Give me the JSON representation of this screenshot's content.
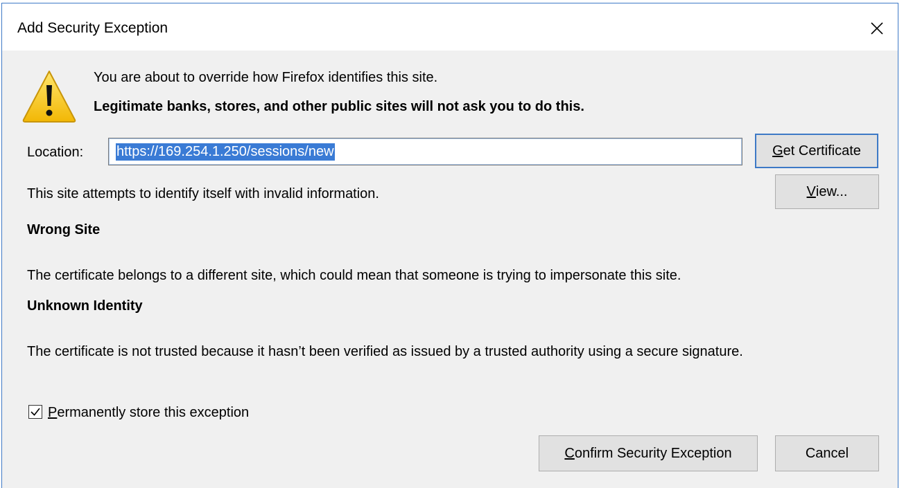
{
  "window": {
    "title": "Add Security Exception"
  },
  "warning": {
    "line1": "You are about to override how Firefox identifies this site.",
    "line2": "Legitimate banks, stores, and other public sites will not ask you to do this."
  },
  "location": {
    "label": "Location:",
    "value": "https://169.254.1.250/sessions/new"
  },
  "buttons": {
    "get_certificate_prefix": "G",
    "get_certificate_rest": "et Certificate",
    "view_prefix": "V",
    "view_rest": "iew...",
    "confirm_prefix": "C",
    "confirm_rest": "onfirm Security Exception",
    "cancel": "Cancel"
  },
  "status": {
    "intro": "This site attempts to identify itself with invalid information.",
    "wrong_site_heading": "Wrong Site",
    "wrong_site_text": "The certificate belongs to a different site, which could mean that someone is trying to impersonate this site.",
    "unknown_identity_heading": "Unknown Identity",
    "unknown_identity_text": "The certificate is not trusted because it hasn’t been verified as issued by a trusted authority using a secure signature."
  },
  "permanent": {
    "checked": true,
    "label_prefix": "P",
    "label_rest": "ermanently store this exception"
  },
  "colors": {
    "accent": "#3d79c6",
    "selection": "#3a7bd5",
    "warning_yellow": "#f5c518",
    "dialog_bg": "#f0f0f0"
  },
  "icons": {
    "close": "close-icon",
    "warning": "warning-triangle-icon",
    "check": "checkmark-icon"
  }
}
